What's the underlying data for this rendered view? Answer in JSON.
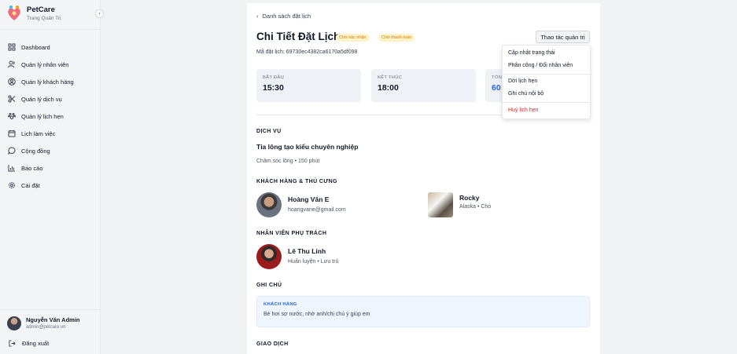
{
  "app": {
    "name": "PetCare",
    "subtitle": "Trang Quản Trị"
  },
  "sidebar": {
    "items": [
      {
        "label": "Dashboard",
        "icon": "grid-icon"
      },
      {
        "label": "Quản lý nhân viên",
        "icon": "users-icon"
      },
      {
        "label": "Quản lý khách hàng",
        "icon": "user-circle-icon"
      },
      {
        "label": "Quản lý dịch vụ",
        "icon": "scissors-icon"
      },
      {
        "label": "Quản lý lịch hẹn",
        "icon": "paw-icon"
      },
      {
        "label": "Lịch làm việc",
        "icon": "calendar-icon"
      },
      {
        "label": "Cộng đồng",
        "icon": "chat-icon"
      },
      {
        "label": "Báo cáo",
        "icon": "chart-icon"
      },
      {
        "label": "Cài đặt",
        "icon": "gear-icon"
      }
    ],
    "user": {
      "name": "Nguyễn Văn Admin",
      "email": "admin@petcare.vn"
    },
    "logout_label": "Đăng xuất"
  },
  "page": {
    "back_label": "Danh sách đặt lịch",
    "title": "Chi Tiết Đặt Lịch",
    "badges": [
      "Chờ xác nhận",
      "Chờ thanh toán"
    ],
    "admin_button": "Thao tác quản trị",
    "booking_code_label": "Mã đặt lịch:",
    "booking_code": "69730ec4382ca6170a5df098",
    "start": {
      "label": "BẮT ĐẦU",
      "value": "15:30"
    },
    "end": {
      "label": "KẾT THÚC",
      "value": "18:00"
    },
    "total": {
      "label": "TỔN",
      "value": "60"
    },
    "sections": {
      "service": "DỊCH VỤ",
      "customer_pet": "KHÁCH HÀNG & THÚ CƯNG",
      "staff": "NHÂN VIÊN PHỤ TRÁCH",
      "notes": "GHI CHÚ",
      "transaction": "GIAO DỊCH"
    },
    "service": {
      "name": "Tỉa lông tạo kiểu chuyên nghiệp",
      "meta": "Chăm sóc lông • 150 phút"
    },
    "customer": {
      "name": "Hoàng Văn E",
      "email": "hoangvane@gmail.com"
    },
    "pet": {
      "name": "Rocky",
      "meta": "Alaska • Chó"
    },
    "staff": {
      "name": "Lê Thu Linh",
      "meta": "Huấn luyện • Lưu trú"
    },
    "note": {
      "label": "KHÁCH HÀNG",
      "text": "Bé hơi sợ nước, nhờ anh/chị chú ý giúp em"
    }
  },
  "menu": {
    "items": [
      "Cập nhật trạng thái",
      "Phân công / Đổi nhân viên",
      "Dời lịch hẹn",
      "Ghi chú nội bộ"
    ],
    "danger": "Huỷ lịch hẹn"
  },
  "colors": {
    "accent": "#2563eb",
    "warning": "#d97706",
    "danger": "#dc2626"
  }
}
